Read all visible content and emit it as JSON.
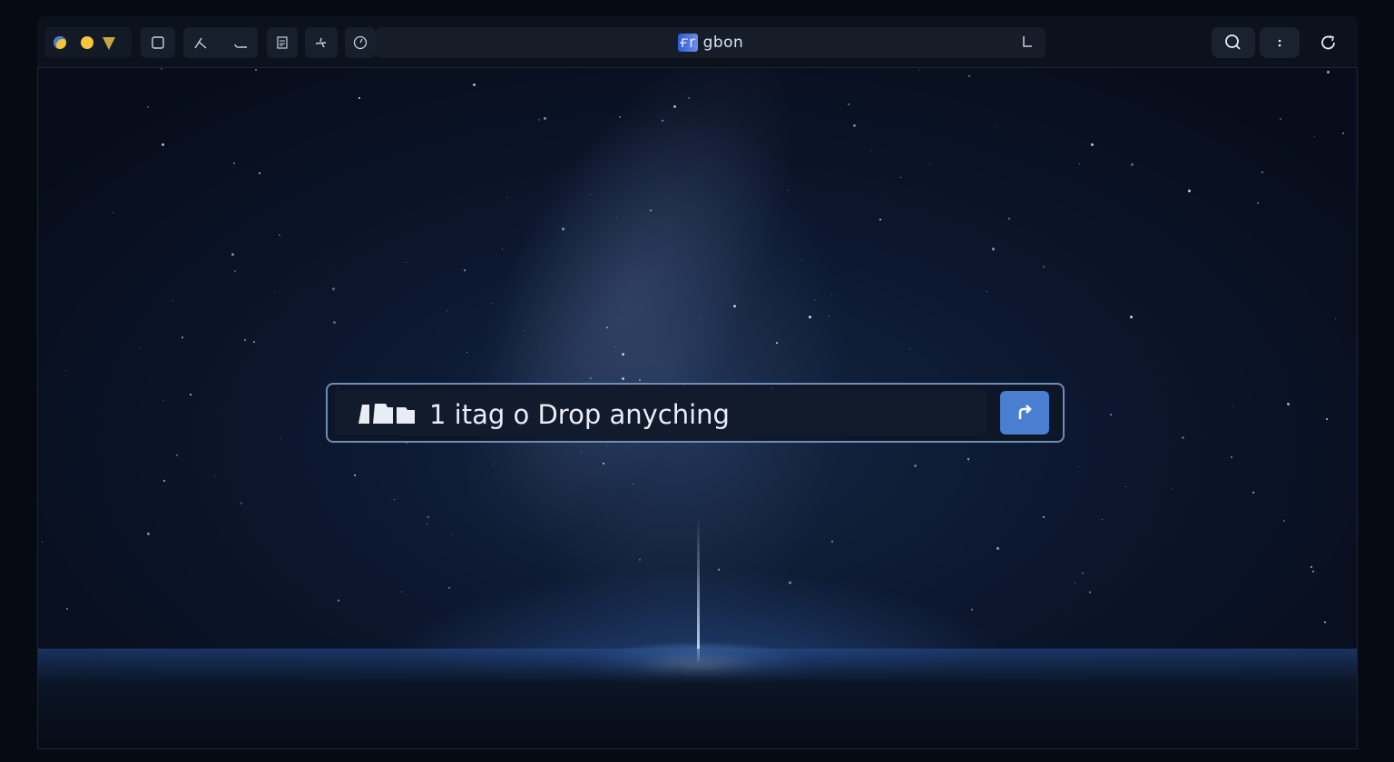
{
  "window": {
    "title": "ғr gbon",
    "title_highlight": "ғr"
  },
  "toolbar": {
    "buttons": [
      {
        "name": "square-icon"
      },
      {
        "name": "draw-icon"
      },
      {
        "name": "curve-icon"
      },
      {
        "name": "document-icon"
      },
      {
        "name": "sparkle-icon"
      },
      {
        "name": "clock-icon"
      }
    ],
    "right_buttons": [
      {
        "name": "search-icon"
      },
      {
        "name": "more-icon"
      },
      {
        "name": "refresh-icon"
      }
    ]
  },
  "search": {
    "placeholder": "1 itag o Drop anyching",
    "submit_icon": "return-arrow-icon"
  },
  "colors": {
    "accent": "#4a7ed0",
    "search_border": "#6f8db8",
    "toolbar_bg": "#0c121c"
  }
}
